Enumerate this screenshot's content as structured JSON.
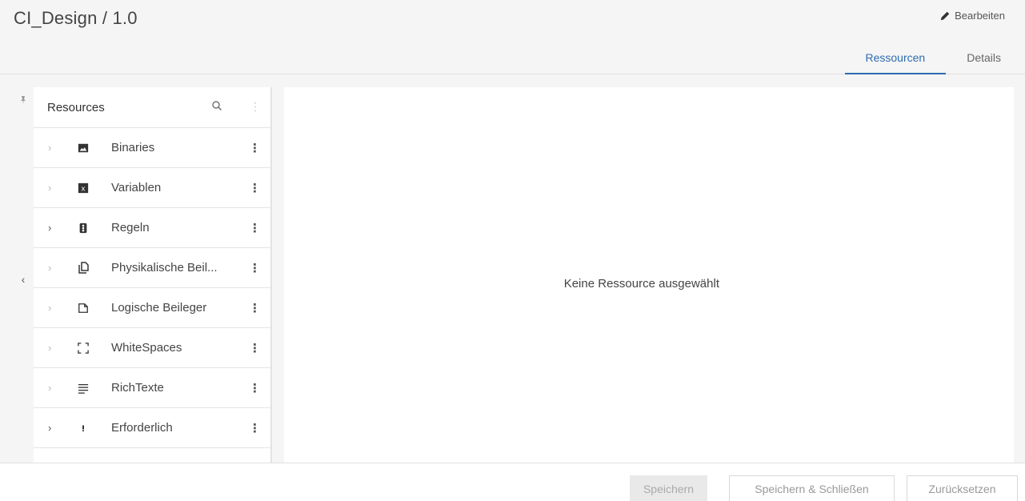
{
  "header": {
    "title": "CI_Design / 1.0",
    "edit_label": "Bearbeiten"
  },
  "tabs": [
    {
      "label": "Ressourcen",
      "active": true
    },
    {
      "label": "Details",
      "active": false
    }
  ],
  "tree": {
    "title": "Resources",
    "items": [
      {
        "label": "Binaries",
        "icon": "image-icon",
        "expandable": false
      },
      {
        "label": "Variablen",
        "icon": "variable-icon",
        "expandable": false
      },
      {
        "label": "Regeln",
        "icon": "rules-icon",
        "expandable": true
      },
      {
        "label": "Physikalische Beil...",
        "icon": "physical-insert-icon",
        "expandable": false
      },
      {
        "label": "Logische Beileger",
        "icon": "logical-insert-icon",
        "expandable": false
      },
      {
        "label": "WhiteSpaces",
        "icon": "whitespace-icon",
        "expandable": false
      },
      {
        "label": "RichTexte",
        "icon": "richtext-icon",
        "expandable": false
      },
      {
        "label": "Erforderlich",
        "icon": "required-icon",
        "expandable": true
      }
    ]
  },
  "detail": {
    "empty_message": "Keine Ressource ausgewählt"
  },
  "footer": {
    "save_label": "Speichern",
    "save_close_label": "Speichern & Schließen",
    "reset_label": "Zurücksetzen"
  },
  "colors": {
    "accent": "#2b6cb0"
  }
}
